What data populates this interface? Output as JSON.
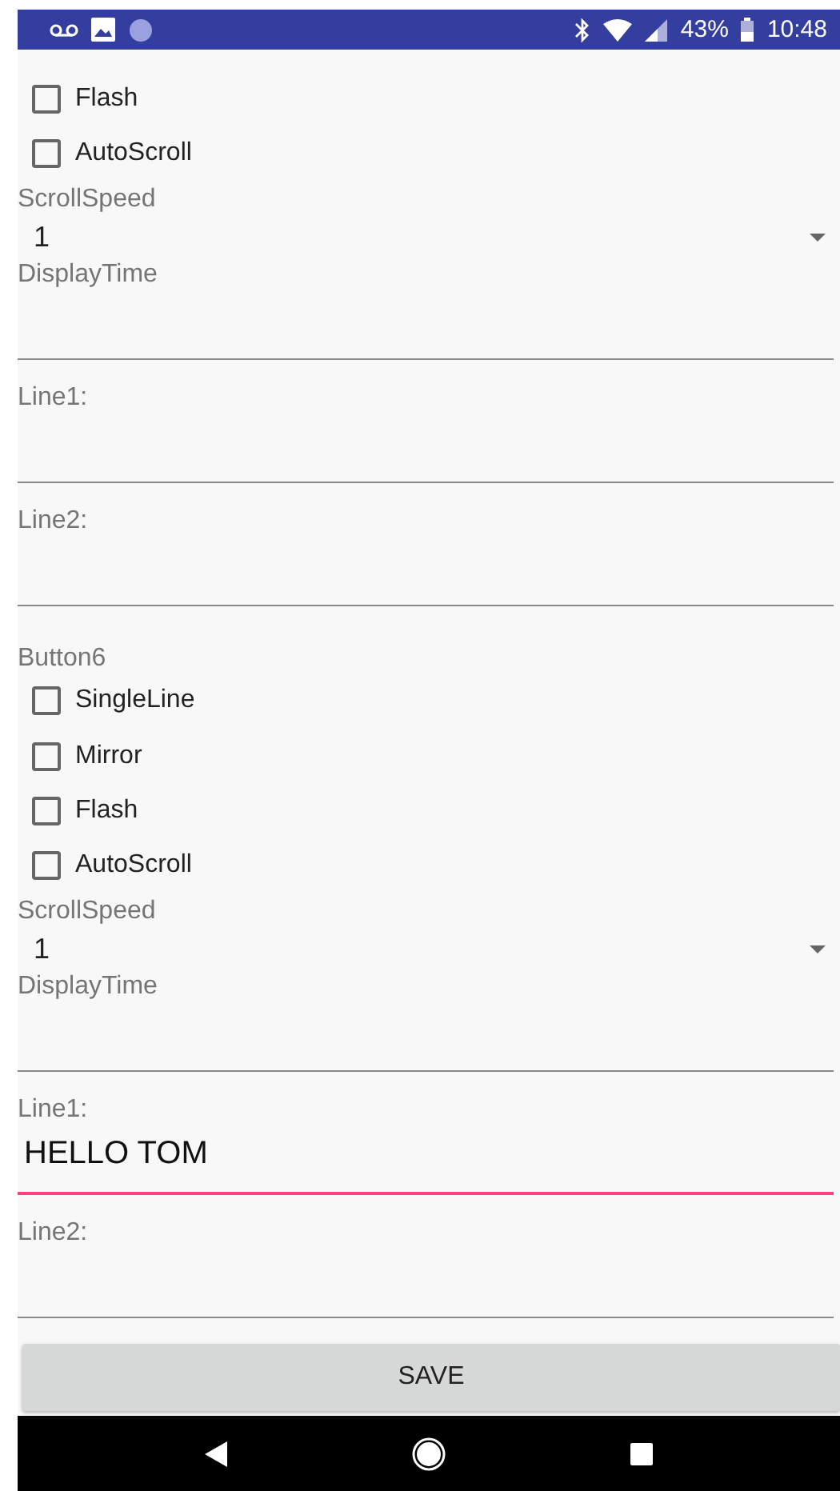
{
  "status_bar": {
    "battery": "43%",
    "time": "10:48"
  },
  "groups": [
    {
      "checkboxes": [
        {
          "label": "Flash",
          "checked": false
        },
        {
          "label": "AutoScroll",
          "checked": false
        }
      ],
      "scroll_speed": {
        "label": "ScrollSpeed",
        "value": "1"
      },
      "fields": [
        {
          "label": "DisplayTime",
          "focused": false
        },
        {
          "label": "Line1:",
          "focused": false
        },
        {
          "label": "Line2:",
          "focused": false
        }
      ]
    },
    {
      "title": "Button6",
      "checkboxes": [
        {
          "label": "SingleLine",
          "checked": false
        },
        {
          "label": "Mirror",
          "checked": false
        },
        {
          "label": "Flash",
          "checked": false
        },
        {
          "label": "AutoScroll",
          "checked": false
        }
      ],
      "scroll_speed": {
        "label": "ScrollSpeed",
        "value": "1"
      },
      "fields": [
        {
          "label": "DisplayTime",
          "focused": false
        },
        {
          "label": "Line1:",
          "value": "HELLO TOM",
          "focused": true
        },
        {
          "label": "Line2:",
          "focused": false
        }
      ]
    }
  ],
  "save_button": "SAVE"
}
